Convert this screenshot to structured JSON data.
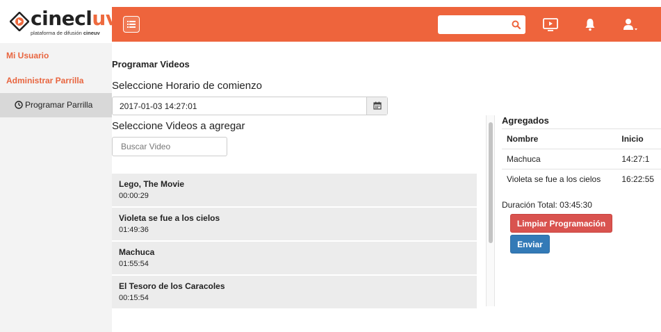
{
  "brand": {
    "name_main": "cinecl",
    "name_accent": "uv",
    "tagline": "plataforma de difusión ",
    "tagline_brand": "cineuv",
    "accent_color": "#ee643c"
  },
  "topbar": {
    "search": {
      "value": "",
      "placeholder": ""
    },
    "icons": [
      "menu-icon",
      "search-icon",
      "tv-icon",
      "bell-icon",
      "user-icon"
    ]
  },
  "sidebar": {
    "user_link": "Mi Usuario",
    "admin_link": "Administrar Parrilla",
    "active_item": "Programar Parrilla"
  },
  "main": {
    "title": "Programar Videos",
    "start_label": "Seleccione Horario de comienzo",
    "start_value": "2017-01-03 14:27:01",
    "videos_label": "Seleccione Videos a agregar",
    "video_search_placeholder": "Buscar Video",
    "videos": [
      {
        "title": "Lego, The Movie",
        "duration": "00:00:29"
      },
      {
        "title": "Violeta se fue a los cielos",
        "duration": "01:49:36"
      },
      {
        "title": "Machuca",
        "duration": "01:55:54"
      },
      {
        "title": "El Tesoro de los Caracoles",
        "duration": "00:15:54"
      }
    ]
  },
  "agregados": {
    "title": "Agregados",
    "columns": [
      "Nombre",
      "Inicio"
    ],
    "rows": [
      {
        "name": "Machuca",
        "start": "14:27:1"
      },
      {
        "name": "Violeta se fue a los cielos",
        "start": "16:22:55"
      }
    ],
    "total": "Duración Total: 03:45:30",
    "clear_label": "Limpiar Programación",
    "send_label": "Enviar",
    "colors": {
      "danger": "#d9534f",
      "primary": "#337ab7"
    }
  }
}
